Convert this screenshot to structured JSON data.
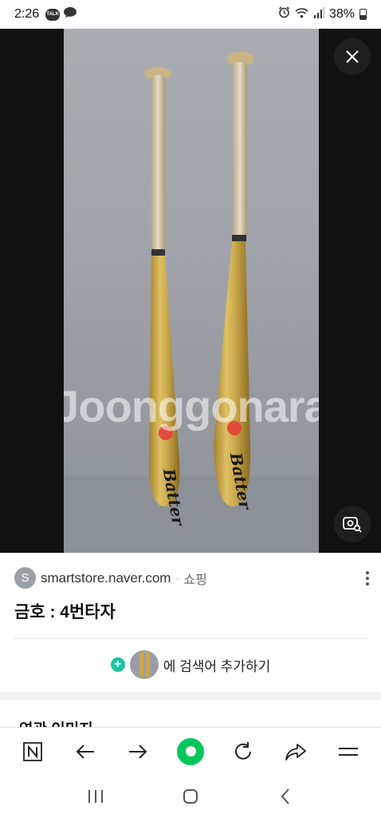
{
  "status_bar": {
    "time": "2:26",
    "notification_icons": [
      "talk-icon",
      "chat-bubble-icon"
    ],
    "system_icons": [
      "alarm-icon",
      "wifi-icon",
      "signal-icon",
      "battery-icon"
    ],
    "battery": "38%"
  },
  "viewer": {
    "watermark": "Joonggonara",
    "close_icon": "close-icon",
    "lens_icon": "image-search-icon"
  },
  "info": {
    "favicon_letter": "S",
    "domain": "smartstore.naver.com",
    "separator": "·",
    "category": "쇼핑",
    "title": "금호 : 4번타자",
    "add_search_label": "에 검색어 추가하기",
    "related_title": "연관 이미지"
  },
  "toolbar": {
    "items": [
      "naver-n-icon",
      "back-arrow-icon",
      "forward-arrow-icon",
      "green-home-icon",
      "refresh-icon",
      "share-icon",
      "menu-icon"
    ]
  },
  "navbar": {
    "items": [
      "recent-apps-icon",
      "home-icon",
      "back-icon"
    ]
  },
  "colors": {
    "accent_green": "#03c75a",
    "add_plus": "#19c3a0",
    "bat_gold": "#c9a64a"
  }
}
